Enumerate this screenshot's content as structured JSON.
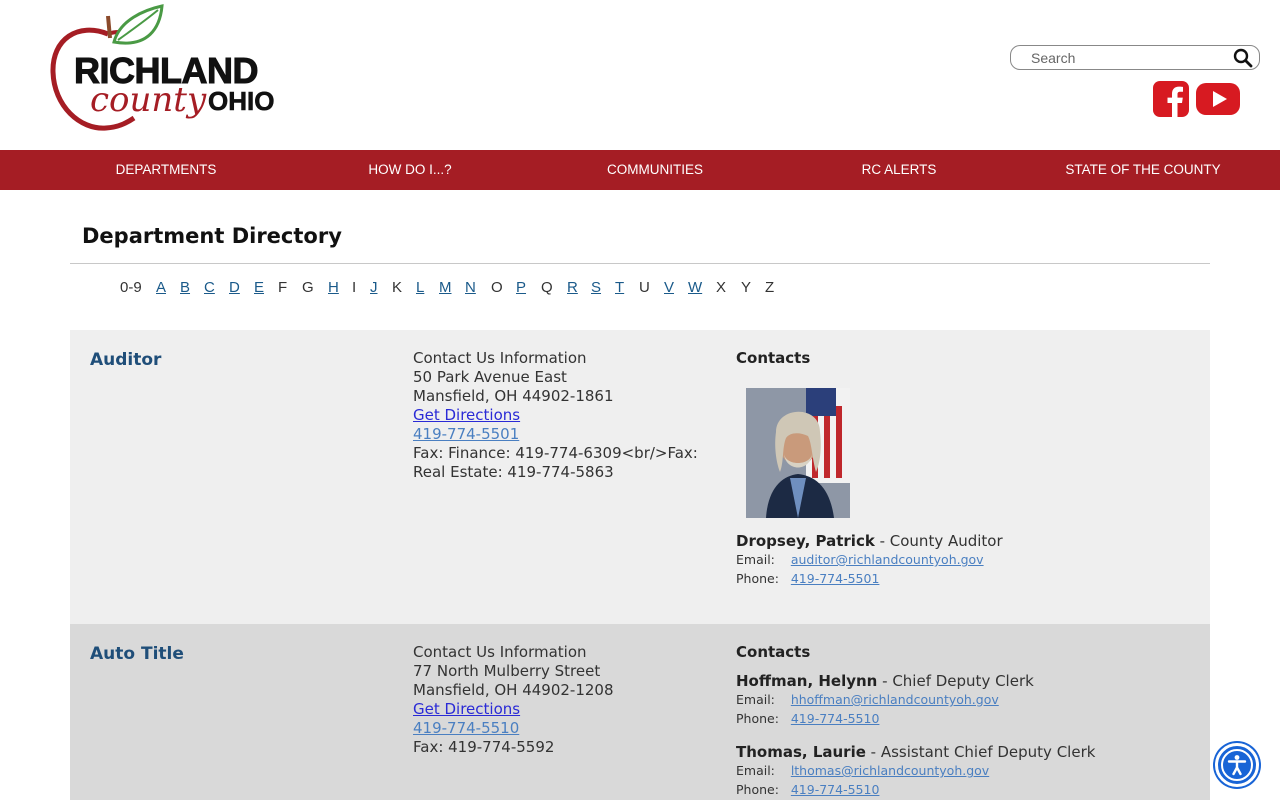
{
  "site": {
    "logo_line1": "RICHLAND",
    "logo_line2": "county",
    "logo_line3": "OHIO"
  },
  "search": {
    "placeholder": "Search"
  },
  "nav": [
    {
      "label": "DEPARTMENTS"
    },
    {
      "label": "HOW DO I...?"
    },
    {
      "label": "COMMUNITIES"
    },
    {
      "label": "RC ALERTS"
    },
    {
      "label": "STATE OF THE COUNTY"
    }
  ],
  "page": {
    "title": "Department Directory"
  },
  "alphabet": [
    {
      "label": "0-9",
      "link": false
    },
    {
      "label": "A",
      "link": true
    },
    {
      "label": "B",
      "link": true
    },
    {
      "label": "C",
      "link": true
    },
    {
      "label": "D",
      "link": true
    },
    {
      "label": "E",
      "link": true
    },
    {
      "label": "F",
      "link": false
    },
    {
      "label": "G",
      "link": false
    },
    {
      "label": "H",
      "link": true
    },
    {
      "label": "I",
      "link": false
    },
    {
      "label": "J",
      "link": true
    },
    {
      "label": "K",
      "link": false
    },
    {
      "label": "L",
      "link": true
    },
    {
      "label": "M",
      "link": true
    },
    {
      "label": "N",
      "link": true
    },
    {
      "label": "O",
      "link": false
    },
    {
      "label": "P",
      "link": true
    },
    {
      "label": "Q",
      "link": false
    },
    {
      "label": "R",
      "link": true
    },
    {
      "label": "S",
      "link": true
    },
    {
      "label": "T",
      "link": true
    },
    {
      "label": "U",
      "link": false
    },
    {
      "label": "V",
      "link": true
    },
    {
      "label": "W",
      "link": true
    },
    {
      "label": "X",
      "link": false
    },
    {
      "label": "Y",
      "link": false
    },
    {
      "label": "Z",
      "link": false
    }
  ],
  "departments": [
    {
      "name": "Auditor",
      "info_heading": "Contact Us Information",
      "address1": "50 Park Avenue East",
      "address2": "Mansfield, OH 44902-1861",
      "directions": "Get Directions",
      "phone": "419-774-5501",
      "fax_line1": "Fax: Finance: 419-774-6309<br/>Fax:",
      "fax_line2": "Real Estate: 419-774-5863",
      "contacts_heading": "Contacts",
      "contacts": [
        {
          "name": "Dropsey, Patrick",
          "title": " - County Auditor",
          "email_label": "Email:",
          "email": "auditor@richlandcountyoh.gov",
          "phone_label": "Phone:",
          "phone": "419-774-5501"
        }
      ]
    },
    {
      "name": "Auto Title",
      "info_heading": "Contact Us Information",
      "address1": "77 North Mulberry Street",
      "address2": "Mansfield, OH 44902-1208",
      "directions": "Get Directions",
      "phone": "419-774-5510",
      "fax_line1": "Fax: 419-774-5592",
      "contacts_heading": "Contacts",
      "contacts": [
        {
          "name": "Hoffman, Helynn",
          "title": " - Chief Deputy Clerk",
          "email_label": "Email:",
          "email": "hhoffman@richlandcountyoh.gov",
          "phone_label": "Phone:",
          "phone": "419-774-5510"
        },
        {
          "name": "Thomas, Laurie",
          "title": " - Assistant Chief Deputy Clerk",
          "email_label": "Email:",
          "email": "lthomas@richlandcountyoh.gov",
          "phone_label": "Phone:",
          "phone": "419-774-5510"
        }
      ]
    }
  ],
  "colors": {
    "brand_red": "#a51d24",
    "dept_name_blue": "#1f4e79",
    "link_blue": "#4a7fc1",
    "accessibility_blue": "#1864d6"
  },
  "icons": {
    "search": "search-icon",
    "facebook": "facebook-icon",
    "youtube": "youtube-icon",
    "accessibility": "accessibility-icon"
  }
}
